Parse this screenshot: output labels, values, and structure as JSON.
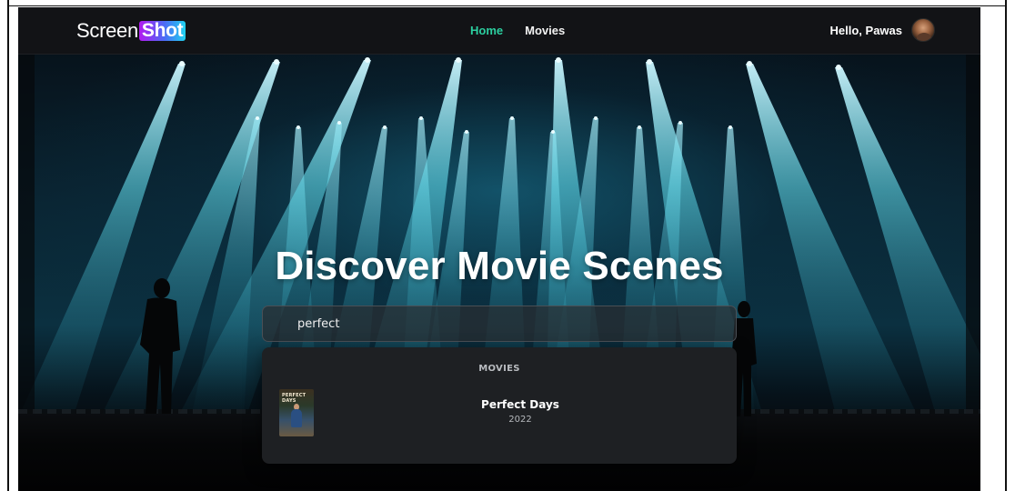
{
  "navbar": {
    "logo_text": "Screen",
    "logo_highlight": "Shot",
    "links": [
      {
        "label": "Home",
        "active": true
      },
      {
        "label": "Movies",
        "active": false
      }
    ],
    "greeting": "Hello, Pawas"
  },
  "hero": {
    "title": "Discover Movie Scenes"
  },
  "search": {
    "value": "perfect"
  },
  "results": {
    "section_label": "MOVIES",
    "items": [
      {
        "title": "Perfect Days",
        "year": "2022",
        "poster_text": "PERFECT DAYS"
      }
    ]
  },
  "colors": {
    "accent_active_link": "#2ccfa0",
    "navbar_bg": "#121316",
    "dropdown_bg": "#1e2023",
    "stage_light": "#5fd6e6"
  }
}
